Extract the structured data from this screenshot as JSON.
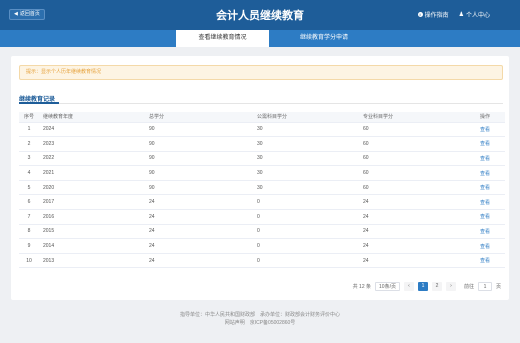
{
  "header": {
    "back_label": "返回首页",
    "title": "会计人员继续教育",
    "guide_label": "操作指南",
    "user_label": "个人中心"
  },
  "tabs": [
    {
      "label": "查看继续教育情况",
      "active": true
    },
    {
      "label": "继续教育学分申请",
      "active": false
    }
  ],
  "notice": "提示：显示个人历年继续教育情况",
  "section_title": "继续教育记录",
  "table": {
    "columns": [
      "序号",
      "继续教育年度",
      "总学分",
      "公需科目学分",
      "专业科目学分",
      "操作"
    ],
    "rows": [
      [
        "1",
        "2024",
        "90",
        "30",
        "60",
        "查看"
      ],
      [
        "2",
        "2023",
        "90",
        "30",
        "60",
        "查看"
      ],
      [
        "3",
        "2022",
        "90",
        "30",
        "60",
        "查看"
      ],
      [
        "4",
        "2021",
        "90",
        "30",
        "60",
        "查看"
      ],
      [
        "5",
        "2020",
        "90",
        "30",
        "60",
        "查看"
      ],
      [
        "6",
        "2017",
        "24",
        "0",
        "24",
        "查看"
      ],
      [
        "7",
        "2016",
        "24",
        "0",
        "24",
        "查看"
      ],
      [
        "8",
        "2015",
        "24",
        "0",
        "24",
        "查看"
      ],
      [
        "9",
        "2014",
        "24",
        "0",
        "24",
        "查看"
      ],
      [
        "10",
        "2013",
        "24",
        "0",
        "24",
        "查看"
      ]
    ]
  },
  "pagination": {
    "total": "共 12 条",
    "page_size": "10条/页",
    "prev": "‹",
    "pages": [
      "1",
      "2"
    ],
    "current": "1",
    "next": "›",
    "goto_label": "前往",
    "goto_value": "1",
    "page_suffix": "页"
  },
  "footer": {
    "line1": "指导单位：中华人民共和国财政部　承办单位：财政部会计财务评价中心",
    "line2": "网站声明　京ICP备05002860号"
  }
}
